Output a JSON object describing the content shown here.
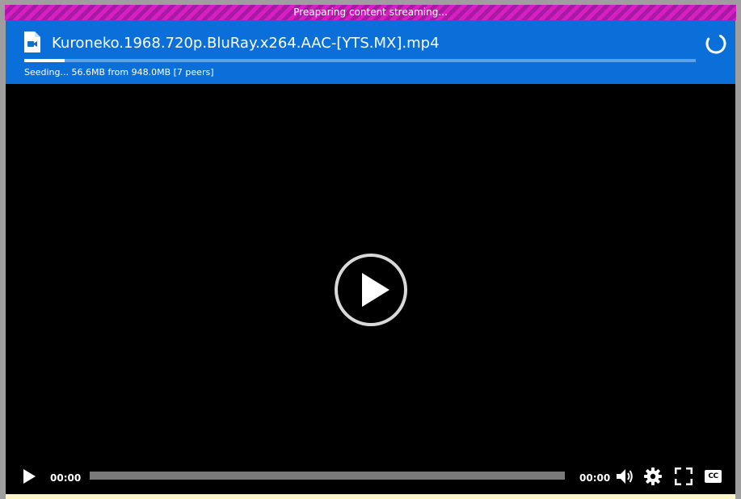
{
  "status_bar": {
    "text": "Preaparing content streaming..."
  },
  "header": {
    "file_icon": "video-file-icon",
    "file_name": "Kuroneko.1968.720p.BluRay.x264.AAC-[YTS.MX].mp4",
    "progress_fraction": 0.06,
    "seed_status": "Seeding... 56.6MB from 948.0MB [7 peers]",
    "spinner_icon": "loading-spinner-icon"
  },
  "player": {
    "big_play_icon": "play-circle-icon",
    "play_icon": "play-icon",
    "current_time": "00:00",
    "duration": "00:00",
    "volume_icon": "volume-icon",
    "settings_icon": "gear-icon",
    "fullscreen_icon": "fullscreen-icon",
    "cc_label": "CC"
  },
  "colors": {
    "header_blue": "#0a6fd8",
    "stripe_pink": "#d91fc4",
    "stripe_purple": "#a61ba1",
    "video_background": "#000000"
  }
}
